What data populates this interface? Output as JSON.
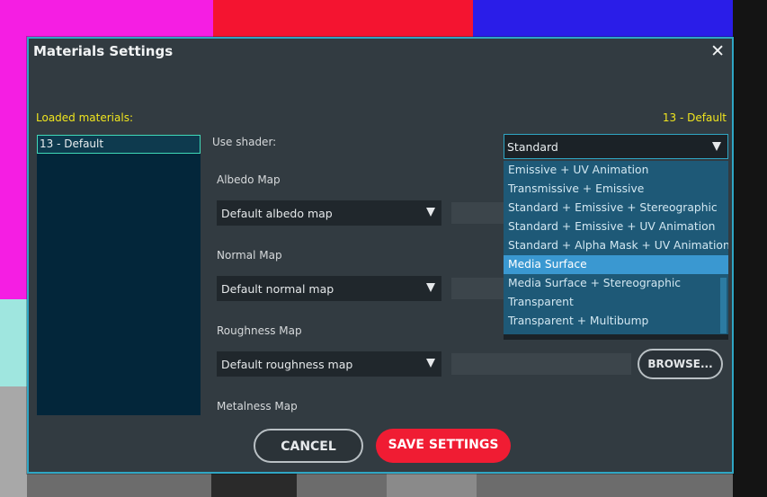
{
  "background": {
    "colors": [
      "#f51ee3",
      "#f41430",
      "#2a1de8",
      "#ffffff",
      "#9fe6df",
      "#a8a8a8",
      "#2a2a2a",
      "#6c6c6c"
    ]
  },
  "dialog": {
    "title": "Materials Settings",
    "close_label": "✕",
    "accent_color": "#2fa6c4",
    "loaded_label": "Loaded materials:",
    "current_material": "13 - Default",
    "materials": [
      {
        "label": "13 - Default",
        "selected": true
      }
    ],
    "use_shader_label": "Use shader:",
    "shader": {
      "value": "Standard",
      "options": [
        "Emissive + UV Animation",
        "Transmissive + Emissive",
        "Standard + Emissive + Stereographic",
        "Standard + Emissive + UV Animation",
        "Standard + Alpha Mask + UV Animation",
        "Media Surface",
        "Media Surface + Stereographic",
        "Transparent",
        "Transparent + Multibump"
      ],
      "highlighted": "Media Surface"
    },
    "maps": [
      {
        "label": "Albedo Map",
        "value": "Default albedo map"
      },
      {
        "label": "Normal Map",
        "value": "Default normal map"
      },
      {
        "label": "Roughness Map",
        "value": "Default roughness map"
      },
      {
        "label": "Metalness Map"
      }
    ],
    "browse_label": "BROWSE...",
    "cancel_label": "CANCEL",
    "save_label": "SAVE SETTINGS",
    "save_color": "#f01c33"
  }
}
